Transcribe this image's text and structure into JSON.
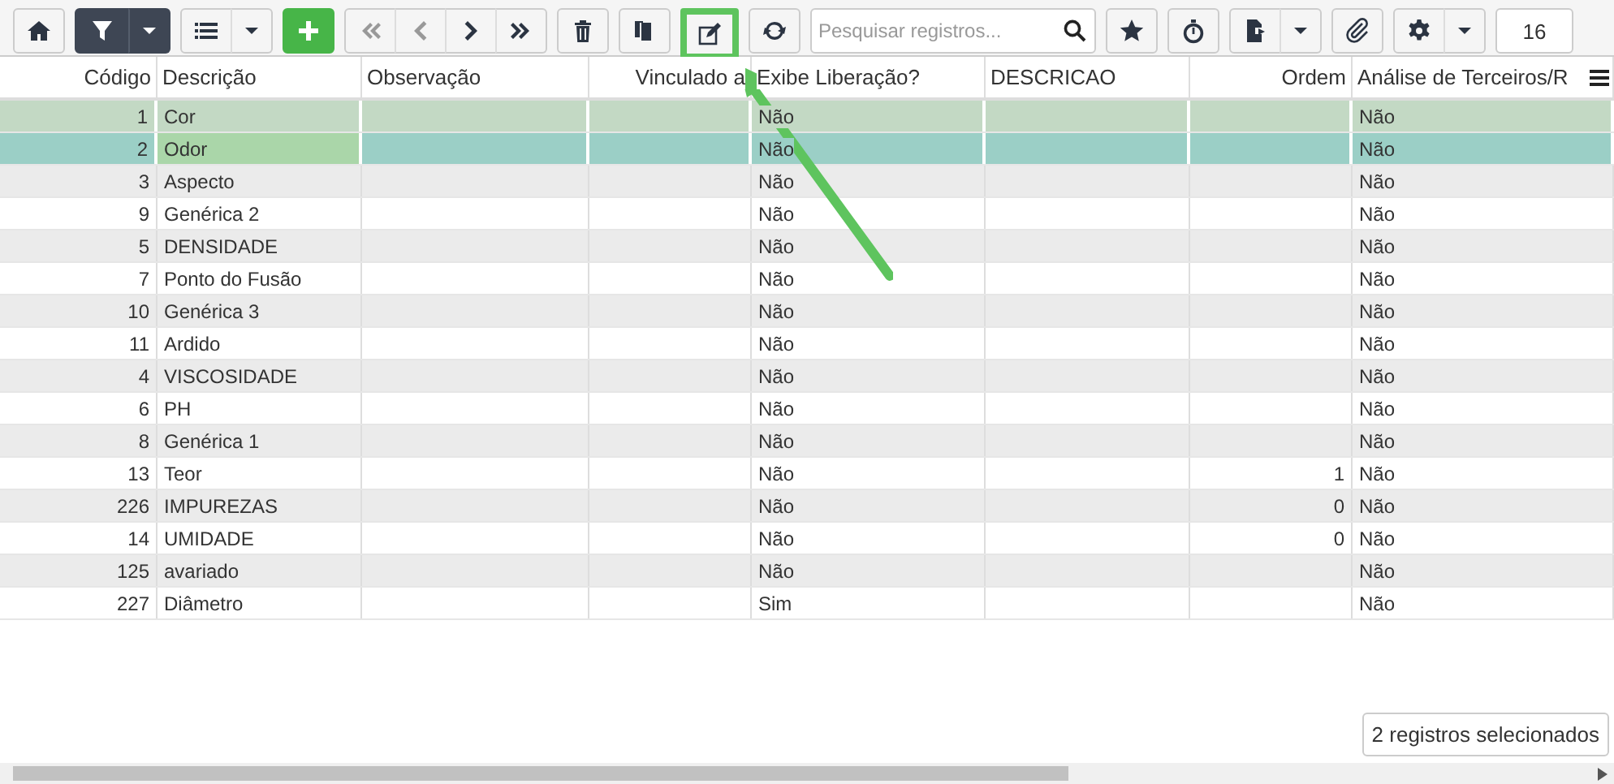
{
  "toolbar": [
    {
      "kind": "group",
      "buttons": [
        {
          "kind": "home"
        }
      ]
    },
    {
      "kind": "group",
      "buttons": [
        {
          "kind": "filter"
        },
        {
          "kind": "caret"
        }
      ]
    },
    {
      "kind": "group",
      "buttons": [
        {
          "kind": "list"
        },
        {
          "kind": "caret"
        }
      ]
    },
    {
      "kind": "group",
      "buttons": [
        {
          "kind": "add"
        }
      ]
    },
    {
      "kind": "group",
      "buttons": [
        {
          "kind": "first",
          "disabled": true
        },
        {
          "kind": "prev",
          "disabled": true
        },
        {
          "kind": "next",
          "disabled": false
        },
        {
          "kind": "last",
          "disabled": false
        }
      ]
    },
    {
      "kind": "group",
      "buttons": [
        {
          "kind": "trash"
        }
      ]
    },
    {
      "kind": "group",
      "buttons": [
        {
          "kind": "copy"
        }
      ]
    },
    {
      "kind": "group",
      "buttons": [
        {
          "kind": "edit",
          "highlighted": true
        }
      ]
    },
    {
      "kind": "group",
      "buttons": [
        {
          "kind": "refresh"
        }
      ]
    },
    {
      "kind": "search",
      "placeholder": "Pesquisar registros..."
    },
    {
      "kind": "group",
      "buttons": [
        {
          "kind": "star"
        }
      ]
    },
    {
      "kind": "group",
      "buttons": [
        {
          "kind": "timer"
        }
      ]
    },
    {
      "kind": "group",
      "buttons": [
        {
          "kind": "export"
        },
        {
          "kind": "caret"
        }
      ]
    },
    {
      "kind": "group",
      "buttons": [
        {
          "kind": "attach"
        }
      ]
    },
    {
      "kind": "group",
      "buttons": [
        {
          "kind": "settings"
        },
        {
          "kind": "caret"
        }
      ]
    },
    {
      "kind": "count",
      "value": "16"
    }
  ],
  "table": {
    "columns": [
      {
        "label": "Código"
      },
      {
        "label": "Descrição"
      },
      {
        "label": "Observação"
      },
      {
        "label": "Vinculado a"
      },
      {
        "label": "Exibe Liberação?"
      },
      {
        "label": "DESCRICAO"
      },
      {
        "label": "Ordem"
      },
      {
        "label": "Análise de Terceiros/R"
      }
    ],
    "rows": [
      {
        "cells": [
          "1",
          "Cor",
          null,
          null,
          "Não",
          null,
          null,
          "Não"
        ],
        "selected": true,
        "current": false
      },
      {
        "cells": [
          "2",
          "Odor",
          null,
          null,
          "Não",
          null,
          null,
          "Não"
        ],
        "selected": true,
        "current": true
      },
      {
        "cells": [
          "3",
          "Aspecto",
          null,
          null,
          "Não",
          null,
          null,
          "Não"
        ],
        "selected": false,
        "current": false
      },
      {
        "cells": [
          "9",
          "Genérica 2",
          null,
          null,
          "Não",
          null,
          null,
          "Não"
        ],
        "selected": false,
        "current": false
      },
      {
        "cells": [
          "5",
          "DENSIDADE",
          null,
          null,
          "Não",
          null,
          null,
          "Não"
        ],
        "selected": false,
        "current": false
      },
      {
        "cells": [
          "7",
          "Ponto do Fusão",
          null,
          null,
          "Não",
          null,
          null,
          "Não"
        ],
        "selected": false,
        "current": false
      },
      {
        "cells": [
          "10",
          "Genérica 3",
          null,
          null,
          "Não",
          null,
          null,
          "Não"
        ],
        "selected": false,
        "current": false
      },
      {
        "cells": [
          "11",
          "Ardido",
          null,
          null,
          "Não",
          null,
          null,
          "Não"
        ],
        "selected": false,
        "current": false
      },
      {
        "cells": [
          "4",
          "VISCOSIDADE",
          null,
          null,
          "Não",
          null,
          null,
          "Não"
        ],
        "selected": false,
        "current": false
      },
      {
        "cells": [
          "6",
          "PH",
          null,
          null,
          "Não",
          null,
          null,
          "Não"
        ],
        "selected": false,
        "current": false
      },
      {
        "cells": [
          "8",
          "Genérica 1",
          null,
          null,
          "Não",
          null,
          null,
          "Não"
        ],
        "selected": false,
        "current": false
      },
      {
        "cells": [
          "13",
          "Teor",
          null,
          null,
          "Não",
          null,
          "1",
          "Não"
        ],
        "selected": false,
        "current": false
      },
      {
        "cells": [
          "226",
          "IMPUREZAS",
          null,
          null,
          "Não",
          null,
          "0",
          "Não"
        ],
        "selected": false,
        "current": false
      },
      {
        "cells": [
          "14",
          "UMIDADE",
          null,
          null,
          "Não",
          null,
          "0",
          "Não"
        ],
        "selected": false,
        "current": false
      },
      {
        "cells": [
          "125",
          "avariado",
          null,
          null,
          "Não",
          null,
          null,
          "Não"
        ],
        "selected": false,
        "current": false
      },
      {
        "cells": [
          "227",
          "Diâmetro",
          null,
          null,
          "Sim",
          null,
          null,
          "Não"
        ],
        "selected": false,
        "current": false
      }
    ]
  },
  "selection_status": "2 registros selecionados"
}
